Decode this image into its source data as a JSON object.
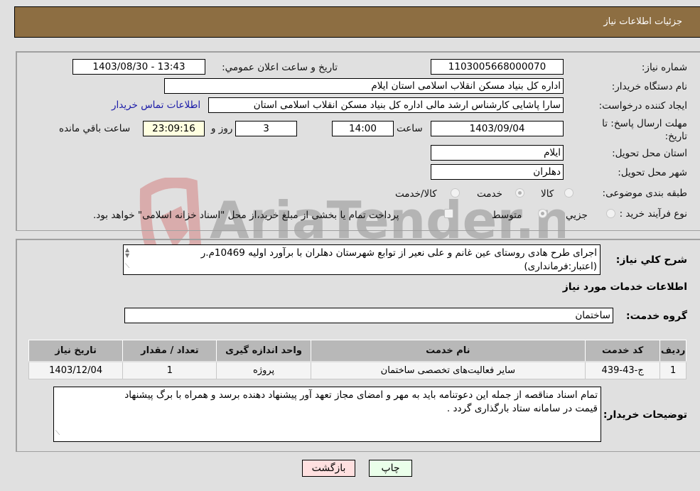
{
  "header": {
    "title": "جزئیات اطلاعات نیاز"
  },
  "form": {
    "need_number": {
      "label": "شماره نیاز:",
      "value": "1103005668000070"
    },
    "announce_datetime": {
      "label": "تاريخ و ساعت اعلان عمومي:",
      "value": "1403/08/30 - 13:43"
    },
    "buyer_org": {
      "label": "نام دستگاه خريدار:",
      "value": "اداره کل بنیاد مسکن انقلاب اسلامی استان ایلام"
    },
    "requester": {
      "label": "ايجاد کننده درخواست:",
      "value": "سارا پاشایی کارشناس ارشد مالی اداره کل بنیاد مسکن انقلاب اسلامی استان",
      "contact_link": "اطلاعات تماس خريدار"
    },
    "deadline": {
      "label_line1": "مهلت ارسال پاسخ: تا",
      "label_line2": "تاريخ:",
      "date": "1403/09/04",
      "time_label": "ساعت",
      "time": "14:00",
      "days": "3",
      "days_label": "روز و",
      "remaining": "23:09:16",
      "remaining_label": "ساعت باقي مانده"
    },
    "province": {
      "label": "استان محل تحويل:",
      "value": "ايلام"
    },
    "city": {
      "label": "شهر محل تحويل:",
      "value": "دهلران"
    },
    "category": {
      "label": "طبقه بندی موضوعی:",
      "options": [
        {
          "label": "كالا",
          "checked": false
        },
        {
          "label": "خدمت",
          "checked": true
        },
        {
          "label": "كالا/خدمت",
          "checked": false
        }
      ]
    },
    "purchase_type": {
      "label": "نوع فرآیند خرید :",
      "options": [
        {
          "label": "جزيي",
          "checked": false
        },
        {
          "label": "متوسط",
          "checked": true
        }
      ],
      "checkbox_label": "پرداخت تمام يا بخشی از مبلغ خريد،از محل \"اسناد خزانه اسلامی\" خواهد بود.",
      "checkbox_checked": false
    }
  },
  "description": {
    "label": "شرح كلي نياز:",
    "value_line1": "اجرای طرح هادی روستای عین غانم و علی نعیر از توابع شهرستان دهلران با برآورد اولیه 10469م.ر",
    "value_line2": "(اعتبار:فرمانداری)"
  },
  "services": {
    "section_title": "اطلاعات خدمات مورد نياز",
    "group_label": "گروه خدمت:",
    "group_value": "ساختمان",
    "table": {
      "headers": [
        "رديف",
        "كد خدمت",
        "نام خدمت",
        "واحد اندازه گيری",
        "تعداد / مقدار",
        "تاريخ نياز"
      ],
      "rows": [
        [
          "1",
          "ج-43-439",
          "سایر فعالیت‌های تخصصی ساختمان",
          "پروژه",
          "1",
          "1403/12/04"
        ]
      ]
    }
  },
  "buyer_notes": {
    "label": "توضيحات خريدار:",
    "line1": "تمام اسناد مناقصه از جمله این دعوتنامه باید به مهر و امضای مجاز تعهد آور پیشنهاد دهنده برسد و همراه با برگ پیشنهاد",
    "line2": "قیمت  در سامانه ستاد بارگذاری گردد ."
  },
  "buttons": {
    "print": "چاپ",
    "back": "بازگشت"
  },
  "watermark": {
    "text": "AriaTender.neT"
  }
}
